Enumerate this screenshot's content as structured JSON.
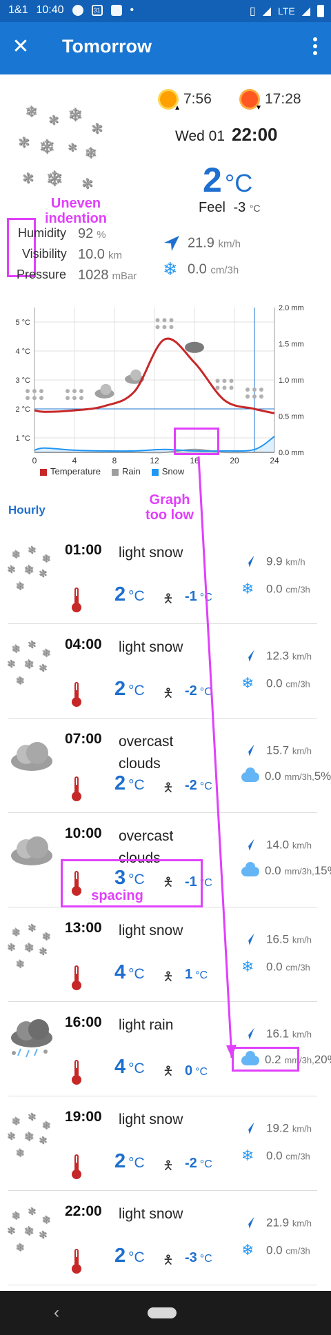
{
  "status_bar": {
    "carrier": "1&1",
    "time": "10:40",
    "calendar_day": "31",
    "network": "LTE"
  },
  "app_bar": {
    "title": "Tomorrow"
  },
  "current": {
    "sunrise": "7:56",
    "sunset": "17:28",
    "date": "Wed 01",
    "time": "22:00",
    "temp": "2",
    "temp_unit": "°C",
    "feel_label": "Feel",
    "feel_value": "-3",
    "feel_unit": "°C",
    "humidity_label": "Humidity",
    "humidity_value": "92",
    "humidity_unit": "%",
    "visibility_label": "Visibility",
    "visibility_value": "10.0",
    "visibility_unit": "km",
    "pressure_label": "Pressure",
    "pressure_value": "1028",
    "pressure_unit": "mBar",
    "wind_value": "21.9",
    "wind_unit": "km/h",
    "snow_value": "0.0",
    "snow_unit": "cm/3h"
  },
  "annotations": {
    "uneven": "Uneven\nindention",
    "graph_low": "Graph\ntoo low",
    "spacing": "spacing"
  },
  "chart_data": {
    "type": "line",
    "x": [
      0,
      1,
      4,
      7,
      10,
      13,
      16,
      19,
      22,
      24
    ],
    "xticks": [
      "0",
      "4",
      "8",
      "12",
      "16",
      "20",
      "24"
    ],
    "yticks_left": [
      "1 °C",
      "2 °C",
      "3 °C",
      "4 °C",
      "5 °C"
    ],
    "yticks_right": [
      "0.0 mm",
      "0.5 mm",
      "1.0 mm",
      "1.5 mm",
      "2.0 mm"
    ],
    "ylim_left": [
      0.5,
      5.5
    ],
    "ylim_right": [
      0,
      2
    ],
    "series": [
      {
        "name": "Temperature",
        "color": "#c62828",
        "values": [
          1.95,
          1.9,
          1.95,
          2.1,
          2.6,
          4.4,
          3.6,
          2.3,
          2.0,
          1.85
        ]
      },
      {
        "name": "Rain",
        "color": "#9e9e9e",
        "values": [
          0,
          0,
          0,
          0,
          0,
          0,
          0.04,
          0,
          0,
          0
        ]
      },
      {
        "name": "Snow",
        "color": "#2196f3",
        "values": [
          0.03,
          0.06,
          0.03,
          0.02,
          0.02,
          0.04,
          0.02,
          0.02,
          0.04,
          0.22
        ]
      }
    ],
    "current_hour": 22,
    "legend": "bottom"
  },
  "hourly": {
    "title": "Hourly",
    "items": [
      {
        "time": "01:00",
        "desc": "light snow",
        "icon": "snow",
        "temp": "2",
        "temp_unit": "°C",
        "feel": "-1",
        "feel_unit": "°C",
        "wind": "9.9",
        "wind_unit": "km/h",
        "precip": "0.0",
        "precip_unit": "cm/3h",
        "extra": ""
      },
      {
        "time": "04:00",
        "desc": "light snow",
        "icon": "snow",
        "temp": "2",
        "temp_unit": "°C",
        "feel": "-2",
        "feel_unit": "°C",
        "wind": "12.3",
        "wind_unit": "km/h",
        "precip": "0.0",
        "precip_unit": "cm/3h",
        "extra": ""
      },
      {
        "time": "07:00",
        "desc": "overcast clouds",
        "icon": "cloud",
        "temp": "2",
        "temp_unit": "°C",
        "feel": "-2",
        "feel_unit": "°C",
        "wind": "15.7",
        "wind_unit": "km/h",
        "precip": "0.0",
        "precip_unit": "mm/3h,",
        "extra": "5%"
      },
      {
        "time": "10:00",
        "desc": "overcast clouds",
        "icon": "cloud",
        "temp": "3",
        "temp_unit": "°C",
        "feel": "-1",
        "feel_unit": "°C",
        "wind": "14.0",
        "wind_unit": "km/h",
        "precip": "0.0",
        "precip_unit": "mm/3h,",
        "extra": "15%"
      },
      {
        "time": "13:00",
        "desc": "light snow",
        "icon": "snow",
        "temp": "4",
        "temp_unit": "°C",
        "feel": "1",
        "feel_unit": "°C",
        "wind": "16.5",
        "wind_unit": "km/h",
        "precip": "0.0",
        "precip_unit": "cm/3h",
        "extra": ""
      },
      {
        "time": "16:00",
        "desc": "light rain",
        "icon": "rain",
        "temp": "4",
        "temp_unit": "°C",
        "feel": "0",
        "feel_unit": "°C",
        "wind": "16.1",
        "wind_unit": "km/h",
        "precip": "0.2",
        "precip_unit": "mm/3h,",
        "extra": "20%"
      },
      {
        "time": "19:00",
        "desc": "light snow",
        "icon": "snow",
        "temp": "2",
        "temp_unit": "°C",
        "feel": "-2",
        "feel_unit": "°C",
        "wind": "19.2",
        "wind_unit": "km/h",
        "precip": "0.0",
        "precip_unit": "cm/3h",
        "extra": ""
      },
      {
        "time": "22:00",
        "desc": "light snow",
        "icon": "snow",
        "temp": "2",
        "temp_unit": "°C",
        "feel": "-3",
        "feel_unit": "°C",
        "wind": "21.9",
        "wind_unit": "km/h",
        "precip": "0.0",
        "precip_unit": "cm/3h",
        "extra": ""
      }
    ]
  }
}
